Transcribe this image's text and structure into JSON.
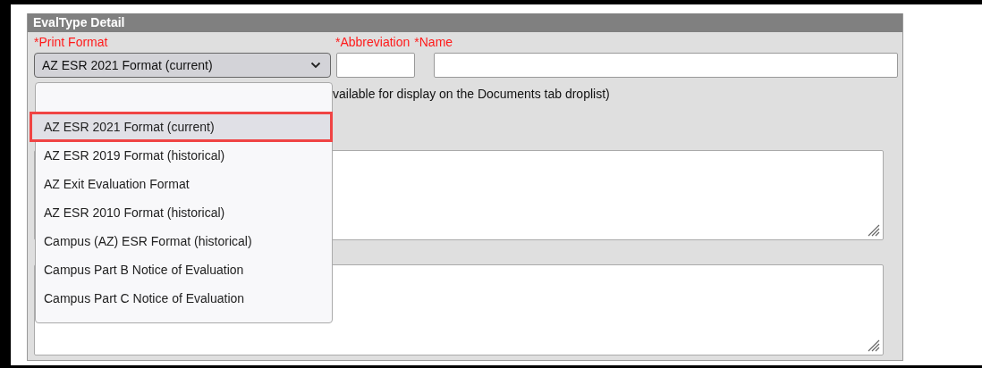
{
  "panel": {
    "title": "EvalType Detail"
  },
  "fields": {
    "print_format": {
      "label": "*Print Format",
      "value": "AZ ESR 2021 Format (current)",
      "expanded": true
    },
    "abbreviation": {
      "label": "*Abbreviation"
    },
    "name": {
      "label": "*Name"
    }
  },
  "hint": "vailable for display on the Documents tab droplist)",
  "dropdown_options": [
    {
      "label": "AZ ESR 2021 Format (current)",
      "selected": true
    },
    {
      "label": "AZ ESR 2019 Format (historical)",
      "selected": false
    },
    {
      "label": "AZ Exit Evaluation Format",
      "selected": false
    },
    {
      "label": "AZ ESR 2010 Format (historical)",
      "selected": false
    },
    {
      "label": "Campus (AZ) ESR Format (historical)",
      "selected": false
    },
    {
      "label": "Campus Part B Notice of Evaluation",
      "selected": false
    },
    {
      "label": "Campus Part C Notice of Evaluation",
      "selected": false
    }
  ]
}
